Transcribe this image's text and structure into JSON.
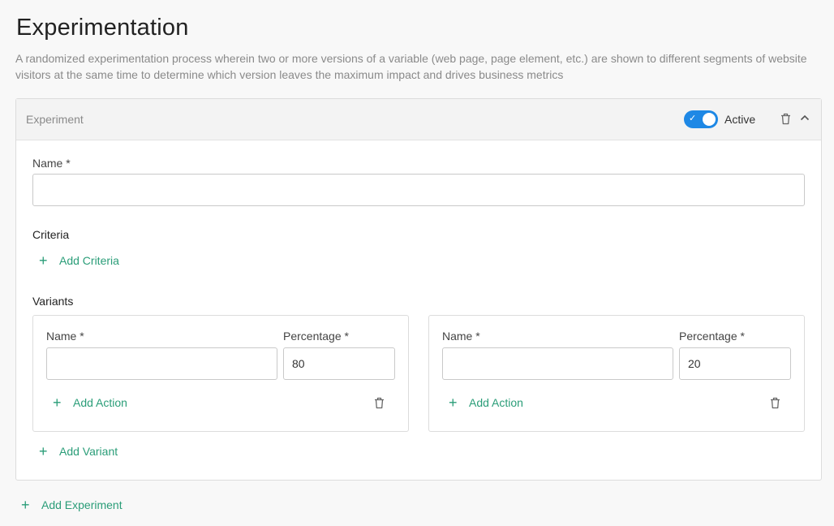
{
  "page": {
    "title": "Experimentation",
    "description": "A randomized experimentation process wherein two or more versions of a variable (web page, page element, etc.) are shown to different segments of website visitors at the same time to determine which version leaves the maximum impact and drives business metrics"
  },
  "experiment": {
    "header_title": "Experiment",
    "active": true,
    "active_label": "Active",
    "name_label": "Name *",
    "name_value": "",
    "criteria_label": "Criteria",
    "add_criteria_label": "Add Criteria",
    "variants_label": "Variants",
    "variants": [
      {
        "name_label": "Name *",
        "name_value": "",
        "percentage_label": "Percentage *",
        "percentage_value": "80",
        "add_action_label": "Add Action"
      },
      {
        "name_label": "Name *",
        "name_value": "",
        "percentage_label": "Percentage *",
        "percentage_value": "20",
        "add_action_label": "Add Action"
      }
    ],
    "add_variant_label": "Add Variant"
  },
  "add_experiment_label": "Add Experiment",
  "icons": {
    "trash": "trash-icon",
    "chevron": "chevron-up-icon",
    "plus": "plus-icon",
    "check": "check-icon"
  },
  "colors": {
    "accent": "#2a9d78",
    "toggle": "#1e88e5"
  }
}
